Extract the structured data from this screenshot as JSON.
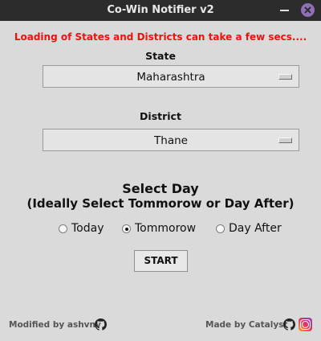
{
  "window": {
    "title": "Co-Win Notifier v2"
  },
  "notice": "Loading of States and Districts can take a few secs....",
  "state": {
    "label": "State",
    "value": "Maharashtra"
  },
  "district": {
    "label": "District",
    "value": "Thane"
  },
  "day": {
    "heading_line1": "Select Day",
    "heading_line2": "(Ideally Select Tommorow or Day After)",
    "options": [
      "Today",
      "Tommorow",
      "Day After"
    ],
    "selected": "Tommorow"
  },
  "start_label": "START",
  "footer": {
    "modified_by": "Modified by ashvnv",
    "made_by": "Made by Catalyst"
  },
  "colors": {
    "notice": "#ee1111",
    "titlebar": "#2c2c2c",
    "close_button": "#8e6fb8"
  },
  "icons": [
    "minimize-icon",
    "close-icon",
    "github-icon",
    "instagram-icon"
  ]
}
